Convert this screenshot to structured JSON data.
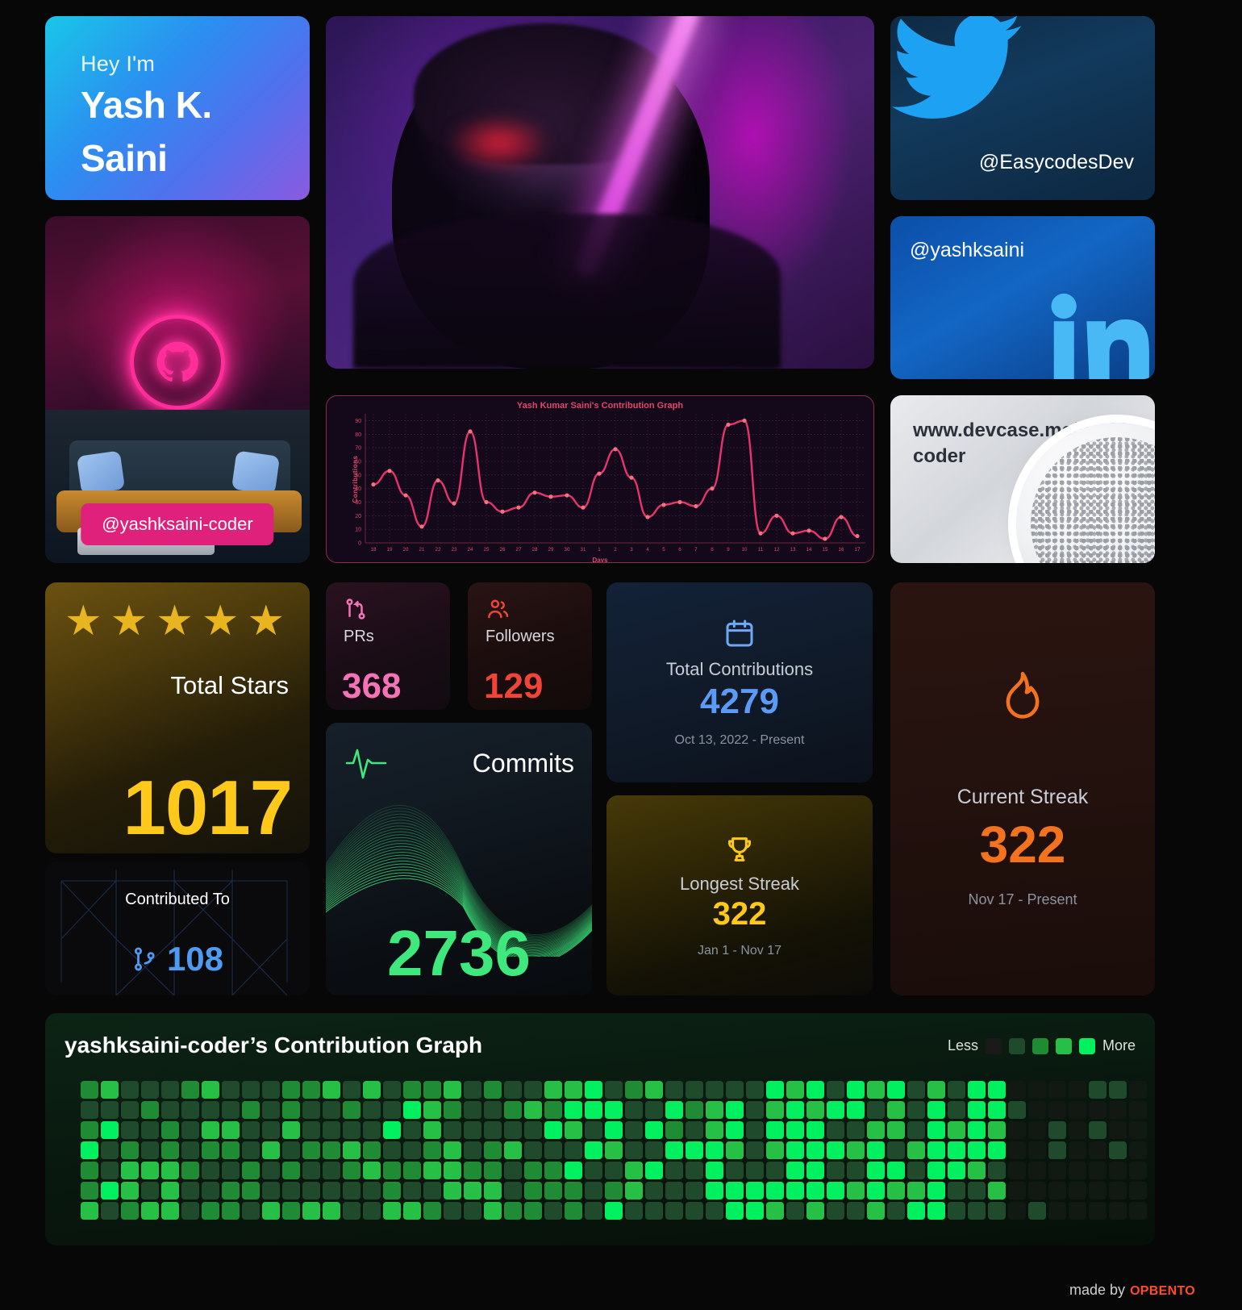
{
  "hero": {
    "greeting": "Hey I'm",
    "line1": "Yash K.",
    "line2": "Saini"
  },
  "social": {
    "twitter_handle": "@EasycodesDev",
    "twitter_icon": "twitter-bird-icon",
    "linkedin_handle": "@yashksaini",
    "linkedin_icon": "linkedin-icon",
    "github_handle": "@yashksaini-coder",
    "github_icon": "github-cat-icon",
    "website_url": "www.devcase.me/yashksaini-coder",
    "website_icon": "globe-icon"
  },
  "stars_card": {
    "label": "Total Stars",
    "value": "1017",
    "star_icon": "star-icon",
    "star_count": 5,
    "color": "#FFC91B"
  },
  "contributed_card": {
    "label": "Contributed To",
    "value": "108",
    "icon": "git-branch-icon",
    "color": "#4E9BF0"
  },
  "prs_card": {
    "label": "PRs",
    "value": "368",
    "icon": "pull-request-icon",
    "color": "#F472B6"
  },
  "followers_card": {
    "label": "Followers",
    "value": "129",
    "icon": "users-icon",
    "color": "#F04438"
  },
  "commits_card": {
    "label": "Commits",
    "value": "2736",
    "icon": "pulse-icon",
    "color": "#3EE87C"
  },
  "total_contributions_card": {
    "label": "Total Contributions",
    "value": "4279",
    "sub": "Oct 13, 2022 - Present",
    "icon": "calendar-icon",
    "color": "#5B9BF5"
  },
  "longest_streak_card": {
    "label": "Longest Streak",
    "value": "322",
    "sub": "Jan 1 - Nov 17",
    "icon": "trophy-icon",
    "color": "#FFC91B"
  },
  "current_streak_card": {
    "label": "Current Streak",
    "value": "322",
    "sub": "Nov 17 - Present",
    "icon": "flame-icon",
    "color": "#F2721E"
  },
  "heatmap": {
    "title": "yashksaini-coder’s Contribution Graph",
    "less_label": "Less",
    "more_label": "More",
    "legend_colors": [
      "#1A1A1A",
      "#1F4A2C",
      "#1F8C35",
      "#26C046",
      "#00F060"
    ]
  },
  "footer": {
    "made_by": "made by",
    "brand": "OPBENTO"
  },
  "chart_data": {
    "type": "line",
    "title": "Yash Kumar Saini's Contribution Graph",
    "xlabel": "Days",
    "ylabel": "Contributions",
    "ylim": [
      0,
      95
    ],
    "yticks": [
      0,
      10,
      20,
      30,
      40,
      50,
      60,
      70,
      80,
      90
    ],
    "grid": true,
    "line_color": "#E8336B",
    "point_color": "#F4717F",
    "categories": [
      "18",
      "19",
      "20",
      "21",
      "22",
      "23",
      "24",
      "25",
      "26",
      "27",
      "28",
      "29",
      "30",
      "31",
      "1",
      "2",
      "3",
      "4",
      "5",
      "6",
      "7",
      "8",
      "9",
      "10",
      "11",
      "12",
      "13",
      "14",
      "15",
      "16",
      "17"
    ],
    "values": [
      43,
      53,
      35,
      12,
      46,
      29,
      82,
      30,
      23,
      26,
      37,
      34,
      35,
      26,
      51,
      69,
      48,
      19,
      28,
      30,
      27,
      40,
      87,
      90,
      7,
      20,
      7,
      9,
      3,
      19,
      5
    ]
  }
}
